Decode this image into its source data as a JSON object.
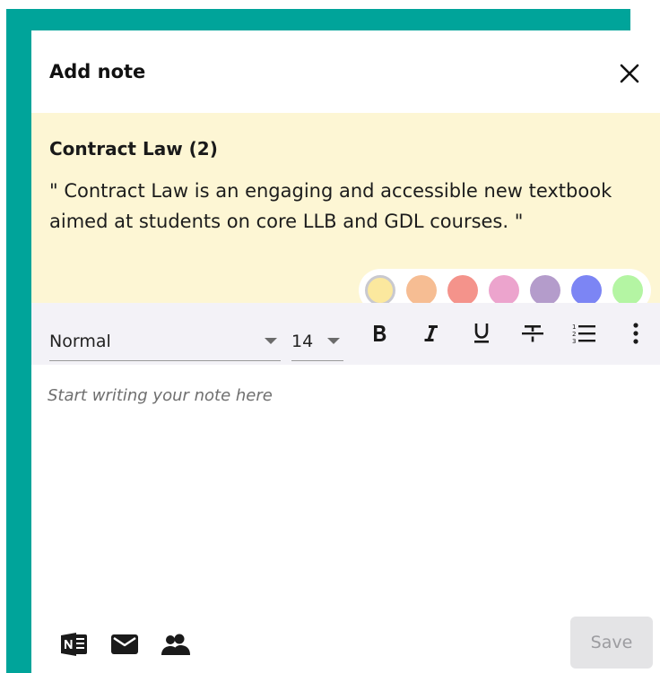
{
  "dialog": {
    "title": "Add note"
  },
  "highlight": {
    "title": "Contract Law (2)",
    "quote": "\" Contract Law is an engaging and accessible new textbook aimed at students on core LLB and GDL courses. \"",
    "background": "#fdf6d4"
  },
  "colors": {
    "teal": "#00a49a",
    "swatches": [
      "#fbe89e",
      "#f6bd93",
      "#f4938b",
      "#eca4cd",
      "#b49ccb",
      "#7c85f4",
      "#b4f5a3"
    ],
    "selected_index": 0
  },
  "toolbar": {
    "font_style": "Normal",
    "font_size": "14",
    "tools": [
      "bold-icon",
      "italic-icon",
      "underline-icon",
      "strikethrough-icon",
      "numbered-list-icon",
      "more-options-icon"
    ]
  },
  "editor": {
    "placeholder": "Start writing your note here"
  },
  "footer": {
    "icons": [
      "onenote-icon",
      "email-icon",
      "share-people-icon"
    ],
    "save_label": "Save"
  }
}
